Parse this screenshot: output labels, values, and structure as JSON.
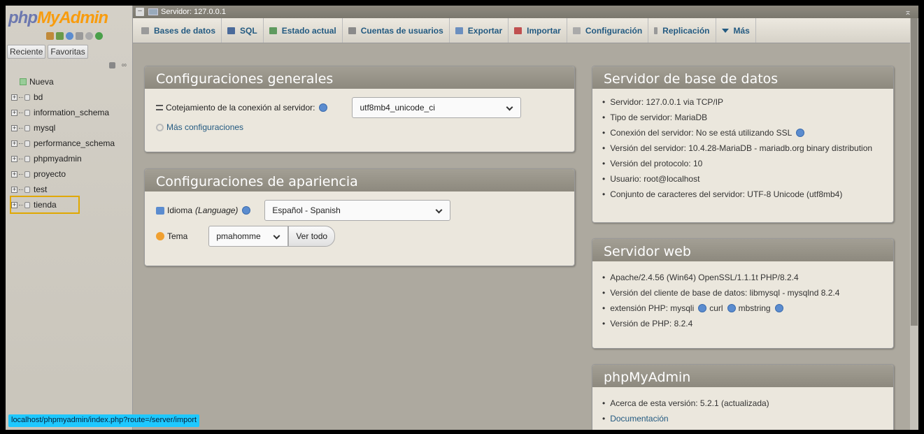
{
  "app": {
    "logo_main": "php",
    "logo_accent": "MyAdmin"
  },
  "sidebar": {
    "tabs": [
      "Reciente",
      "Favoritas"
    ],
    "tree": [
      {
        "label": "Nueva",
        "type": "new"
      },
      {
        "label": "bd"
      },
      {
        "label": "information_schema"
      },
      {
        "label": "mysql"
      },
      {
        "label": "performance_schema"
      },
      {
        "label": "phpmyadmin"
      },
      {
        "label": "proyecto"
      },
      {
        "label": "test"
      },
      {
        "label": "tienda",
        "highlighted": true
      }
    ]
  },
  "status_url": "localhost/phpmyadmin/index.php?route=/server/import",
  "server_bar": {
    "title": "Servidor: 127.0.0.1"
  },
  "nav": {
    "tabs": [
      {
        "label": "Bases de datos",
        "icon": "database-icon",
        "color": "#9a9a9a"
      },
      {
        "label": "SQL",
        "icon": "sql-icon",
        "color": "#4a6a9a"
      },
      {
        "label": "Estado actual",
        "icon": "status-icon",
        "color": "#5f9a5f"
      },
      {
        "label": "Cuentas de usuarios",
        "icon": "users-icon",
        "color": "#8a8a8a"
      },
      {
        "label": "Exportar",
        "icon": "export-icon",
        "color": "#6b8fbf"
      },
      {
        "label": "Importar",
        "icon": "import-icon",
        "color": "#c05050"
      },
      {
        "label": "Configuración",
        "icon": "wrench-icon",
        "color": "#aaa"
      },
      {
        "label": "Replicación",
        "icon": "replication-icon",
        "color": "#999"
      },
      {
        "label": "Más",
        "icon": "chevron-down-icon",
        "color": "#235a81"
      }
    ]
  },
  "general": {
    "title": "Configuraciones generales",
    "collation_label": "Cotejamiento de la conexión al servidor:",
    "collation_value": "utf8mb4_unicode_ci",
    "more_settings": "Más configuraciones"
  },
  "appearance": {
    "title": "Configuraciones de apariencia",
    "language_label": "Idioma",
    "language_sub": "(Language)",
    "language_value": "Español - Spanish",
    "theme_label": "Tema",
    "theme_value": "pmahomme",
    "view_all": "Ver todo"
  },
  "db_server": {
    "title": "Servidor de base de datos",
    "items": [
      "Servidor: 127.0.0.1 via TCP/IP",
      "Tipo de servidor: MariaDB",
      "Conexión del servidor: No se está utilizando SSL",
      "Versión del servidor: 10.4.28-MariaDB - mariadb.org binary distribution",
      "Versión del protocolo: 10",
      "Usuario: root@localhost",
      "Conjunto de caracteres del servidor: UTF-8 Unicode (utf8mb4)"
    ]
  },
  "web_server": {
    "title": "Servidor web",
    "items": [
      "Apache/2.4.56 (Win64) OpenSSL/1.1.1t PHP/8.2.4",
      "Versión del cliente de base de datos: libmysql - mysqlnd 8.2.4",
      "extensión PHP: mysqli",
      "Versión de PHP: 8.2.4"
    ],
    "ext_extra": [
      "curl",
      "mbstring"
    ]
  },
  "pma": {
    "title": "phpMyAdmin",
    "items": [
      "Acerca de esta versión: 5.2.1 (actualizada)",
      "Documentación"
    ]
  }
}
